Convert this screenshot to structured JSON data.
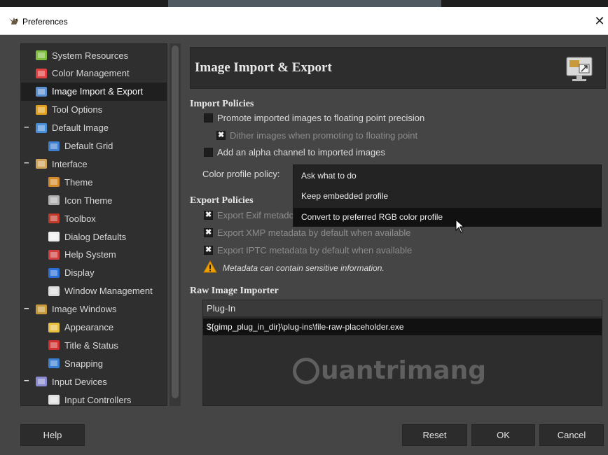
{
  "window": {
    "title": "Preferences",
    "close_glyph": "✕"
  },
  "sidebar": {
    "items": [
      {
        "label": "System Resources",
        "icon": "system-resources-icon",
        "depth": 0
      },
      {
        "label": "Color Management",
        "icon": "color-management-icon",
        "depth": 0
      },
      {
        "label": "Image Import & Export",
        "icon": "image-import-export-icon",
        "depth": 0,
        "selected": true
      },
      {
        "label": "Tool Options",
        "icon": "tool-options-icon",
        "depth": 0
      },
      {
        "label": "Default Image",
        "icon": "default-image-icon",
        "depth": 0,
        "expander": "−"
      },
      {
        "label": "Default Grid",
        "icon": "default-grid-icon",
        "depth": 1
      },
      {
        "label": "Interface",
        "icon": "interface-icon",
        "depth": 0,
        "expander": "−"
      },
      {
        "label": "Theme",
        "icon": "theme-icon",
        "depth": 1
      },
      {
        "label": "Icon Theme",
        "icon": "icon-theme-icon",
        "depth": 1
      },
      {
        "label": "Toolbox",
        "icon": "toolbox-icon",
        "depth": 1
      },
      {
        "label": "Dialog Defaults",
        "icon": "dialog-defaults-icon",
        "depth": 1
      },
      {
        "label": "Help System",
        "icon": "help-system-icon",
        "depth": 1
      },
      {
        "label": "Display",
        "icon": "display-icon",
        "depth": 1
      },
      {
        "label": "Window Management",
        "icon": "window-management-icon",
        "depth": 1
      },
      {
        "label": "Image Windows",
        "icon": "image-windows-icon",
        "depth": 0,
        "expander": "−"
      },
      {
        "label": "Appearance",
        "icon": "appearance-icon",
        "depth": 1
      },
      {
        "label": "Title & Status",
        "icon": "title-status-icon",
        "depth": 1
      },
      {
        "label": "Snapping",
        "icon": "snapping-icon",
        "depth": 1
      },
      {
        "label": "Input Devices",
        "icon": "input-devices-icon",
        "depth": 0,
        "expander": "−"
      },
      {
        "label": "Input Controllers",
        "icon": "input-controllers-icon",
        "depth": 1
      }
    ]
  },
  "panel": {
    "title": "Image Import & Export",
    "import": {
      "heading": "Import Policies",
      "promote_float": {
        "label": "Promote imported images to floating point precision",
        "checked": false
      },
      "dither": {
        "label": "Dither images when promoting to floating point",
        "checked": true,
        "disabled": true
      },
      "alpha": {
        "label": "Add an alpha channel to imported images",
        "checked": false
      },
      "color_profile_label": "Color profile policy:"
    },
    "dropdown": {
      "options": [
        "Ask what to do",
        "Keep embedded profile",
        "Convert to preferred RGB color profile"
      ],
      "highlighted": 2
    },
    "export": {
      "heading": "Export Policies",
      "exif": {
        "label": "Export Exif metadata by default when available",
        "visible_label": "Export Exif metadc",
        "checked": true
      },
      "xmp": {
        "label": "Export XMP metadata by default when available",
        "checked": true
      },
      "iptc": {
        "label": "Export IPTC metadata by default when available",
        "checked": true
      },
      "warning": "Metadata can contain sensitive information."
    },
    "raw": {
      "heading": "Raw Image Importer",
      "column_header": "Plug-In",
      "rows": [
        "${gimp_plug_in_dir}\\plug-ins\\file-raw-placeholder.exe"
      ]
    },
    "watermark": "uantrimang"
  },
  "buttons": {
    "help": "Help",
    "reset": "Reset",
    "ok": "OK",
    "cancel": "Cancel"
  },
  "colors": {
    "background": "#454545",
    "sidebar": "#2f2f2f",
    "selection": "#1f1f1f",
    "warning": "#f0a000"
  }
}
